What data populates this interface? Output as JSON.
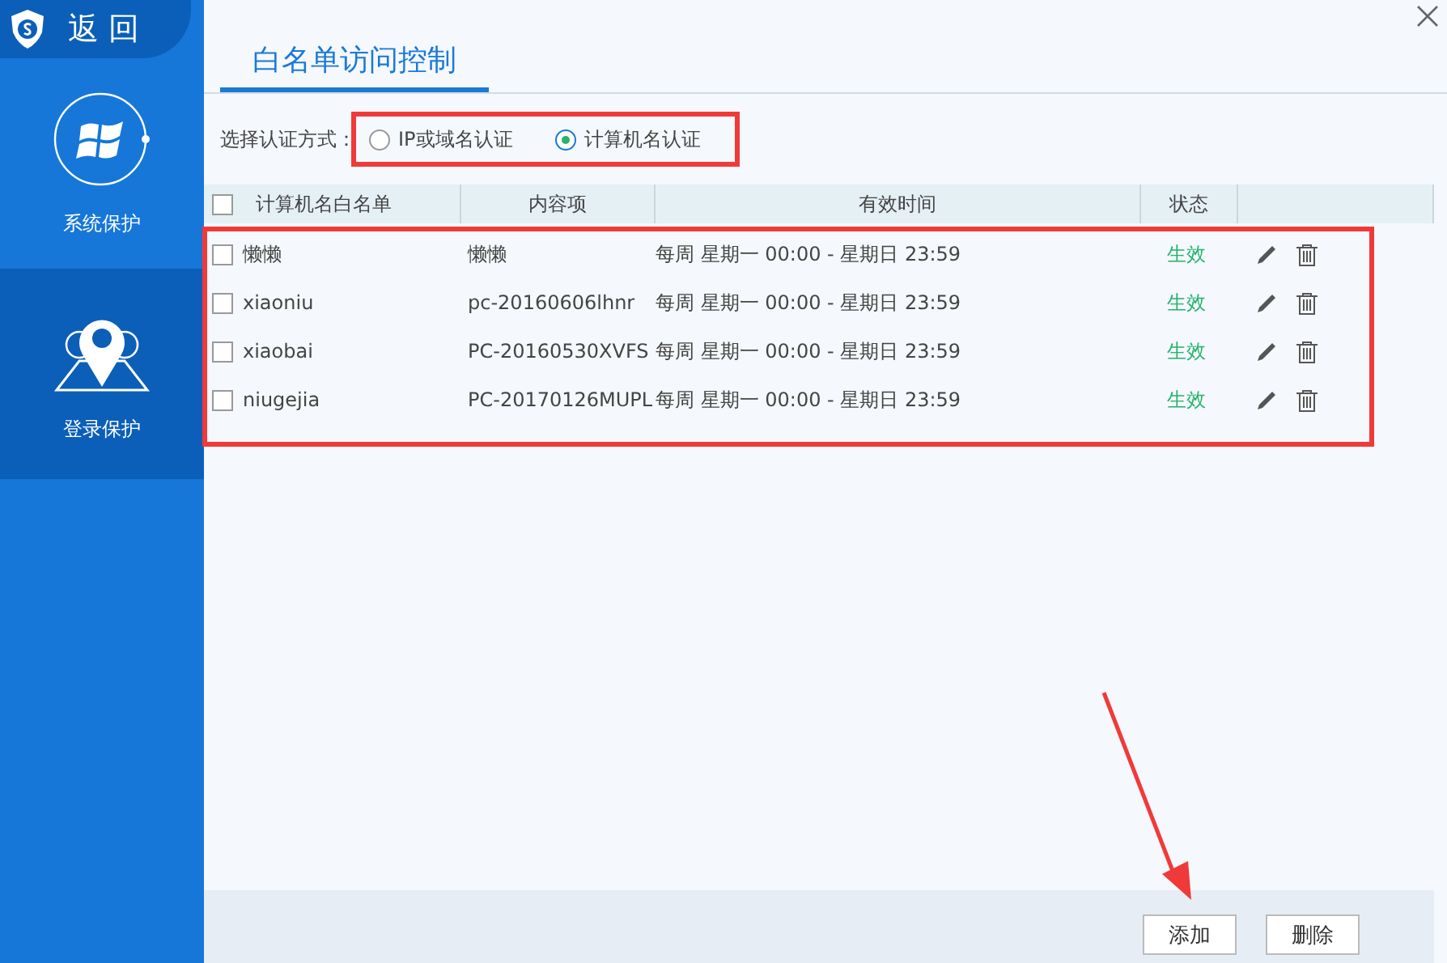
{
  "sidebar": {
    "back_label": "返 回",
    "items": [
      {
        "label": "系统保护",
        "kind": "windows",
        "selected": false
      },
      {
        "label": "登录保护",
        "kind": "location",
        "selected": true
      }
    ]
  },
  "title_tab": {
    "label": "白名单访问控制",
    "selected": true
  },
  "auth_mode": {
    "label": "选择认证方式：",
    "options": [
      {
        "label": "IP或域名认证",
        "selected": false
      },
      {
        "label": "计算机名认证",
        "selected": true
      }
    ]
  },
  "table": {
    "select_all_checked": false,
    "columns": [
      "计算机名白名单",
      "内容项",
      "有效时间",
      "状态"
    ],
    "rows": [
      {
        "checked": false,
        "name": "懒懒",
        "content": "懒懒",
        "time": "每周 星期一 00:00 - 星期日 23:59",
        "status": "生效"
      },
      {
        "checked": false,
        "name": "xiaoniu",
        "content": "pc-20160606lhnr",
        "time": "每周 星期一 00:00 - 星期日 23:59",
        "status": "生效"
      },
      {
        "checked": false,
        "name": "xiaobai",
        "content": "PC-20160530XVFS",
        "time": "每周 星期一 00:00 - 星期日 23:59",
        "status": "生效"
      },
      {
        "checked": false,
        "name": "niugejia",
        "content": "PC-20170126MUPL",
        "time": "每周 星期一 00:00 - 星期日 23:59",
        "status": "生效"
      }
    ]
  },
  "buttons": [
    "添加",
    "删除"
  ]
}
